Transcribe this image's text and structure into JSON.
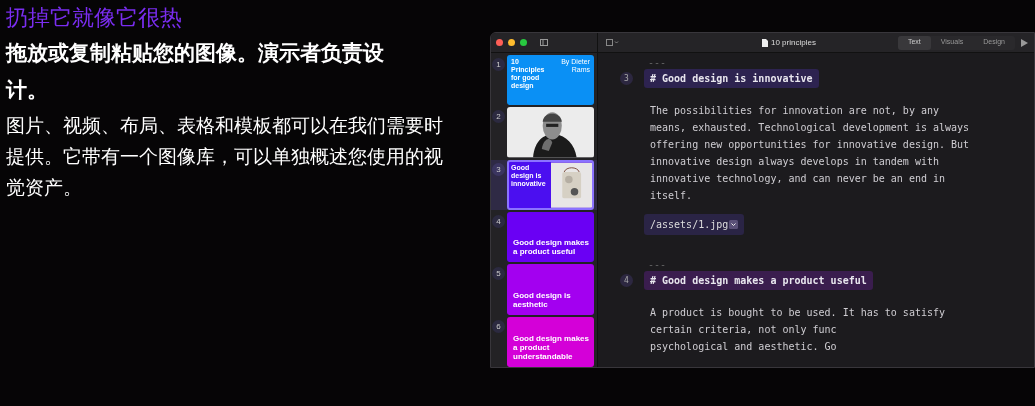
{
  "intro": {
    "title": "扔掉它就像它很热",
    "heading": "拖放或复制粘贴您的图像。演示者负责设计。",
    "body": "图片、视频、布局、表格和模板都可以在我们需要时提供。它带有一个图像库，可以单独概述您使用的视觉资产。"
  },
  "app": {
    "document_title": "10 principles",
    "view_tabs": [
      {
        "label": "Text",
        "selected": true
      },
      {
        "label": "Visuals",
        "selected": false
      },
      {
        "label": "Design",
        "selected": false
      }
    ],
    "slides": [
      {
        "number": "1",
        "kind": "title",
        "title": "10 Principles for good design",
        "byline": "By Dieter Rams",
        "color": "#0a90f5",
        "selected": false
      },
      {
        "number": "2",
        "kind": "picture",
        "selected": false
      },
      {
        "number": "3",
        "kind": "split",
        "title": "Good design is innovative",
        "color": "#4b0ff0",
        "selected": true
      },
      {
        "number": "4",
        "kind": "statement",
        "title": "Good design makes a product useful",
        "color": "#6a00f4",
        "selected": false
      },
      {
        "number": "5",
        "kind": "statement",
        "title": "Good design is aesthetic",
        "color": "#a300f0",
        "selected": false
      },
      {
        "number": "6",
        "kind": "statement",
        "title": "Good design makes a product understandable",
        "color": "#d400d8",
        "selected": false
      }
    ],
    "blocks": [
      {
        "separator": "---",
        "number": "3",
        "heading": "# Good design is innovative",
        "color": "#2d2350",
        "lines": [
          "The possibilities for innovation are not, by any",
          "means, exhausted. Technological development is always",
          "offering new opportunities for innovative design. But",
          "innovative design always develops in tandem with",
          "innovative technology, and can never be an end in",
          "itself."
        ],
        "asset": "/assets/1.jpg"
      },
      {
        "separator": "---",
        "number": "4",
        "heading": "# Good design makes a product useful",
        "color": "#3a1d4e",
        "lines": [
          "A product is bought to be used. It has to satisfy",
          "certain criteria, not only func",
          "psychological and aesthetic. Go"
        ]
      }
    ]
  }
}
